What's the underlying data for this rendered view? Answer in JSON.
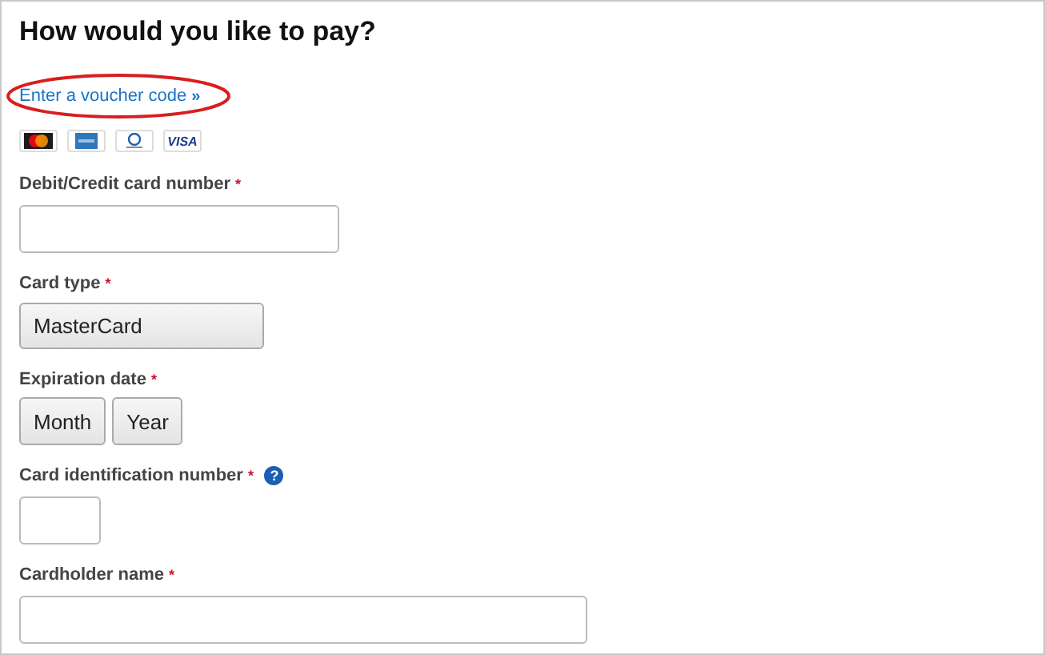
{
  "title": "How would you like to pay?",
  "voucher_link": {
    "label": "Enter a voucher code",
    "icon": "»",
    "circled": true
  },
  "card_logos": [
    {
      "kind": "mastercard"
    },
    {
      "kind": "amex"
    },
    {
      "kind": "diners"
    },
    {
      "kind": "visa",
      "label": "VISA"
    }
  ],
  "fields": [
    {
      "kind": "text",
      "label": "Debit/Credit card number",
      "required_mark": "*"
    },
    {
      "kind": "select",
      "label": "Card type",
      "required_mark": "*",
      "value": "MasterCard"
    },
    {
      "kind": "buttons",
      "label": "Expiration date",
      "required_mark": "*",
      "options": [
        "Month",
        "Year"
      ]
    },
    {
      "kind": "short_text",
      "label": "Card identification number",
      "required_mark": "*",
      "help": "?"
    },
    {
      "kind": "long_text",
      "label": "Cardholder name",
      "required_mark": "*"
    }
  ]
}
